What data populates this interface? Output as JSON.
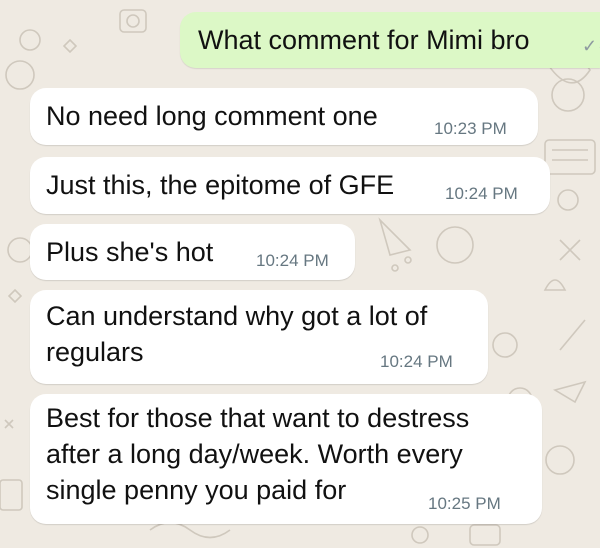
{
  "colors": {
    "chat_background": "#efeae2",
    "incoming_bubble": "#ffffff",
    "outgoing_bubble": "#dcf8c6",
    "timestamp_text": "#667781"
  },
  "messages": [
    {
      "direction": "outgoing",
      "text": "What comment for Mimi bro",
      "status_icon": "read-tick-icon"
    },
    {
      "direction": "incoming",
      "text": "No need long comment one",
      "time": "10:23 PM"
    },
    {
      "direction": "incoming",
      "text": "Just this, the epitome of GFE",
      "time": "10:24 PM"
    },
    {
      "direction": "incoming",
      "text": "Plus she's hot",
      "time": "10:24 PM"
    },
    {
      "direction": "incoming",
      "text": "Can understand why got a lot of\nregulars",
      "time": "10:24 PM"
    },
    {
      "direction": "incoming",
      "text": "Best for those that want to destress\nafter a long day/week. Worth every\nsingle penny you paid for",
      "time": "10:25 PM"
    }
  ]
}
